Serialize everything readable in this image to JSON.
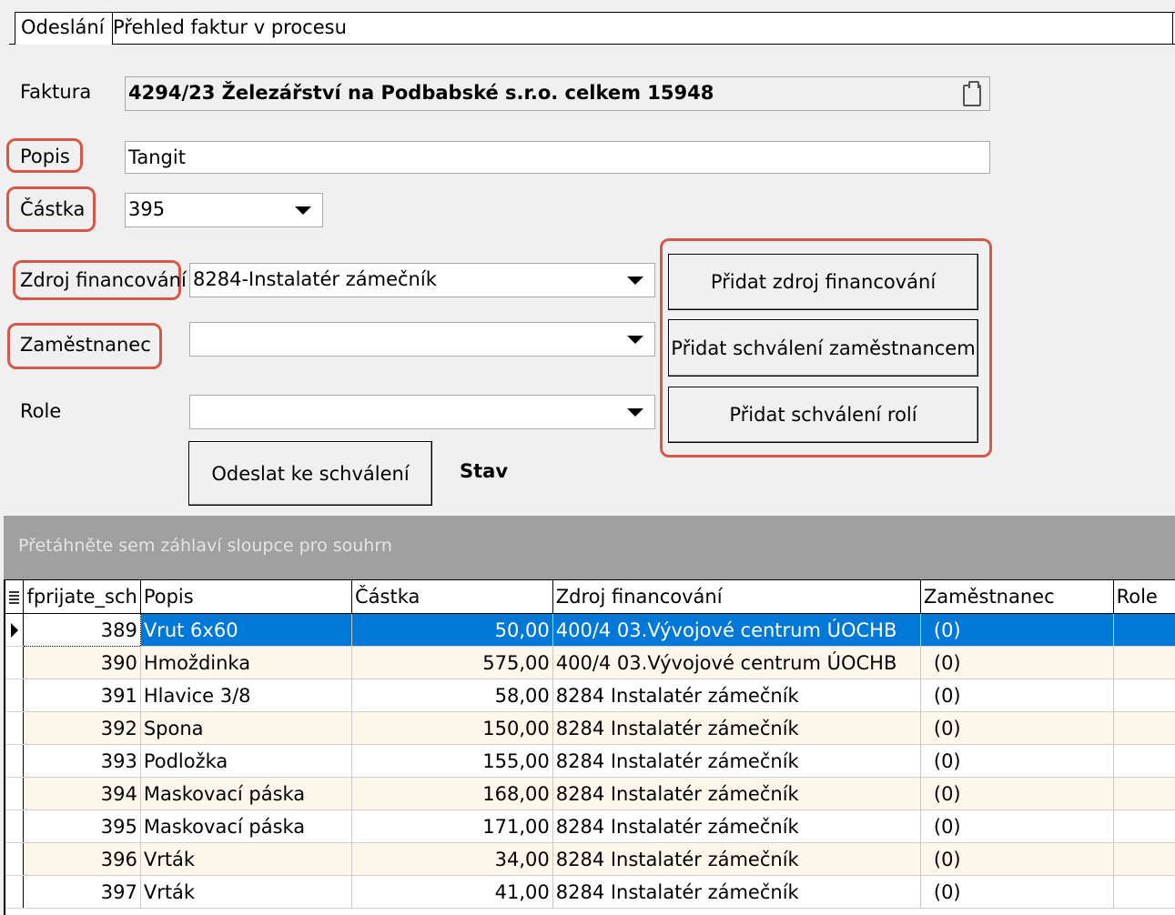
{
  "tabs": [
    {
      "label": "Odeslání",
      "active": true
    },
    {
      "label": "Přehled faktur v procesu",
      "active": false
    }
  ],
  "form": {
    "faktura_label": "Faktura",
    "faktura_value": "4294/23 Železářství na Podbabské s.r.o. celkem 15948",
    "popis_label": "Popis",
    "popis_value": "Tangit",
    "castka_label": "Částka",
    "castka_value": "395",
    "zdroj_label": "Zdroj financování",
    "zdroj_value": "8284-Instalatér zámečník",
    "zamestnanec_label": "Zaměstnanec",
    "zamestnanec_value": "",
    "role_label": "Role",
    "role_value": ""
  },
  "buttons": {
    "pridat_zdroj": "Přidat zdroj financování",
    "pridat_zamestnanec": "Přidat schválení zaměstnancem",
    "pridat_role": "Přidat schválení rolí",
    "odeslat": "Odeslat ke schválení"
  },
  "stav_label": "Stav",
  "grid": {
    "group_hint": "Přetáhněte sem záhlaví sloupce pro souhrn",
    "columns": [
      "fprijate_sch",
      "Popis",
      "Částka",
      "Zdroj financování",
      "Zaměstnanec",
      "Role"
    ],
    "rows": [
      {
        "id": "389",
        "popis": "Vrut 6x60",
        "castka": "50,00",
        "zdroj": "400/4 03.Vývojové centrum ÚOCHB",
        "zam": "(0)",
        "role": ""
      },
      {
        "id": "390",
        "popis": "Hmoždinka",
        "castka": "575,00",
        "zdroj": "400/4 03.Vývojové centrum ÚOCHB",
        "zam": "(0)",
        "role": ""
      },
      {
        "id": "391",
        "popis": "Hlavice 3/8",
        "castka": "58,00",
        "zdroj": "8284 Instalatér zámečník",
        "zam": "(0)",
        "role": ""
      },
      {
        "id": "392",
        "popis": "Spona",
        "castka": "150,00",
        "zdroj": "8284 Instalatér zámečník",
        "zam": "(0)",
        "role": ""
      },
      {
        "id": "393",
        "popis": "Podložka",
        "castka": "155,00",
        "zdroj": "8284 Instalatér zámečník",
        "zam": "(0)",
        "role": ""
      },
      {
        "id": "394",
        "popis": "Maskovací páska",
        "castka": "168,00",
        "zdroj": "8284 Instalatér zámečník",
        "zam": "(0)",
        "role": ""
      },
      {
        "id": "395",
        "popis": "Maskovací páska",
        "castka": "171,00",
        "zdroj": "8284 Instalatér zámečník",
        "zam": "(0)",
        "role": ""
      },
      {
        "id": "396",
        "popis": "Vrták",
        "castka": "34,00",
        "zdroj": "8284 Instalatér zámečník",
        "zam": "(0)",
        "role": ""
      },
      {
        "id": "397",
        "popis": "Vrták",
        "castka": "41,00",
        "zdroj": "8284 Instalatér zámečník",
        "zam": "(0)",
        "role": ""
      }
    ]
  },
  "colors": {
    "selection": "#0078d7",
    "highlight": "#d6584a",
    "row_alt": "#fdf7eb"
  }
}
